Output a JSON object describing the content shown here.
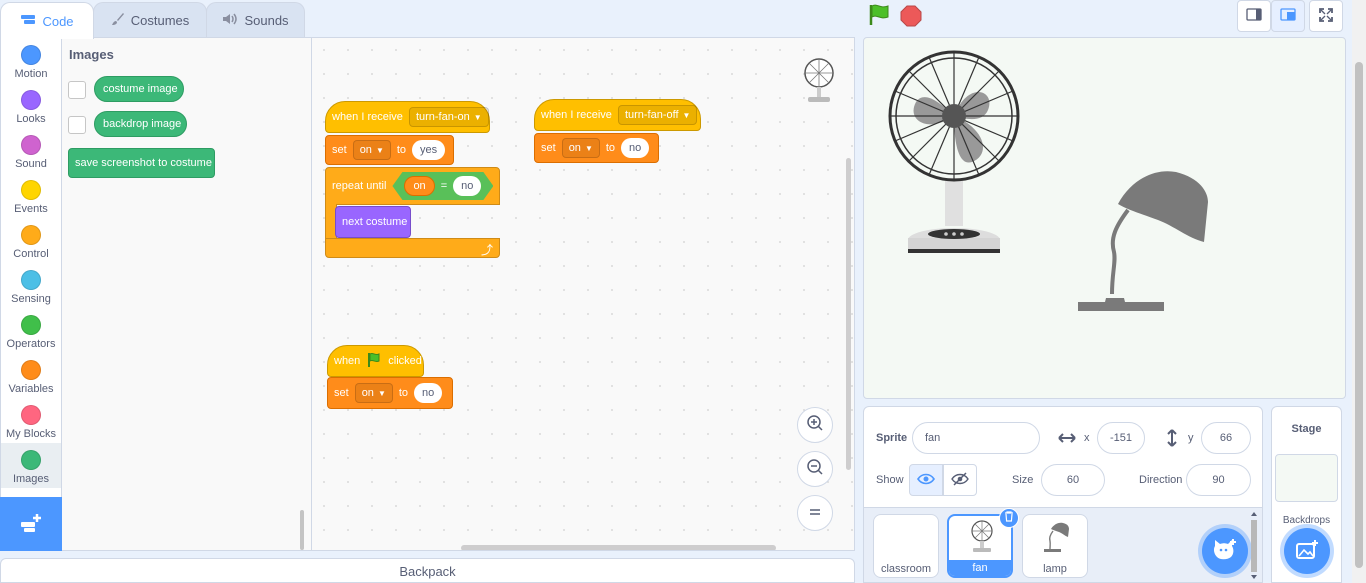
{
  "tabs": [
    {
      "label": "Code",
      "icon": "code-icon"
    },
    {
      "label": "Costumes",
      "icon": "brush-icon"
    },
    {
      "label": "Sounds",
      "icon": "speaker-icon"
    }
  ],
  "categories": [
    {
      "label": "Motion",
      "color": "#4c97ff"
    },
    {
      "label": "Looks",
      "color": "#9966ff"
    },
    {
      "label": "Sound",
      "color": "#cf63cf"
    },
    {
      "label": "Events",
      "color": "#ffd500"
    },
    {
      "label": "Control",
      "color": "#ffab19"
    },
    {
      "label": "Sensing",
      "color": "#4cbfe6"
    },
    {
      "label": "Operators",
      "color": "#40bf4a"
    },
    {
      "label": "Variables",
      "color": "#ff8c1a"
    },
    {
      "label": "My Blocks",
      "color": "#ff6680"
    },
    {
      "label": "Images",
      "color": "#3cb878"
    }
  ],
  "flyout": {
    "title": "Images",
    "blocks": [
      "costume image",
      "backdrop image",
      "save screenshot to costume"
    ]
  },
  "scripts": {
    "s1": {
      "hat": "when I receive",
      "msg": "turn-fan-on",
      "set": "set",
      "var": "on",
      "to": "to",
      "val": "yes",
      "repeat": "repeat until",
      "cond_var": "on",
      "eq": "=",
      "cond_val": "no",
      "costume": "next costume"
    },
    "s2": {
      "hat": "when I receive",
      "msg": "turn-fan-off",
      "set": "set",
      "var": "on",
      "to": "to",
      "val": "no"
    },
    "s3": {
      "when": "when",
      "clicked": "clicked",
      "set": "set",
      "var": "on",
      "to": "to",
      "val": "no"
    }
  },
  "backpack": "Backpack",
  "sprite_info": {
    "sprite_label": "Sprite",
    "sprite_name": "fan",
    "x_label": "x",
    "x": "-151",
    "y_label": "y",
    "y": "66",
    "show_label": "Show",
    "size_label": "Size",
    "size": "60",
    "direction_label": "Direction",
    "direction": "90"
  },
  "sprites": [
    {
      "name": "classroom"
    },
    {
      "name": "fan"
    },
    {
      "name": "lamp"
    }
  ],
  "stage_panel": {
    "title": "Stage",
    "backdrops": "Backdrops"
  },
  "colors": {
    "accent": "#4c97ff",
    "images": "#3cb878",
    "events": "#ffbf00",
    "variables": "#ff8c1a",
    "looks": "#9966ff",
    "operators": "#59c059"
  }
}
